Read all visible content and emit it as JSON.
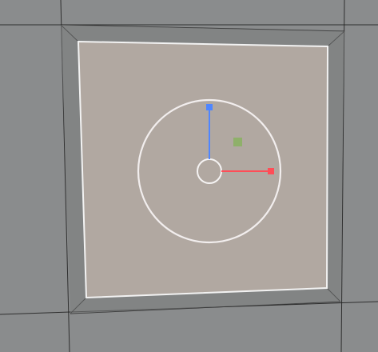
{
  "viewport": {
    "colors": {
      "background": "#8a8c8d",
      "grid_edge": "#1f1f1f",
      "selected_face": "#b1a8a1",
      "selected_outline": "#f2f2f2",
      "gizmo_ring": "#f2eeee",
      "x_axis": "#ff4d57",
      "z_axis": "#4f86ff",
      "plane_handle": "#8fb06a"
    },
    "gizmo": {
      "type": "move",
      "axes": [
        "x-axis",
        "z-axis"
      ],
      "plane_handle": "xz-plane-handle"
    }
  }
}
